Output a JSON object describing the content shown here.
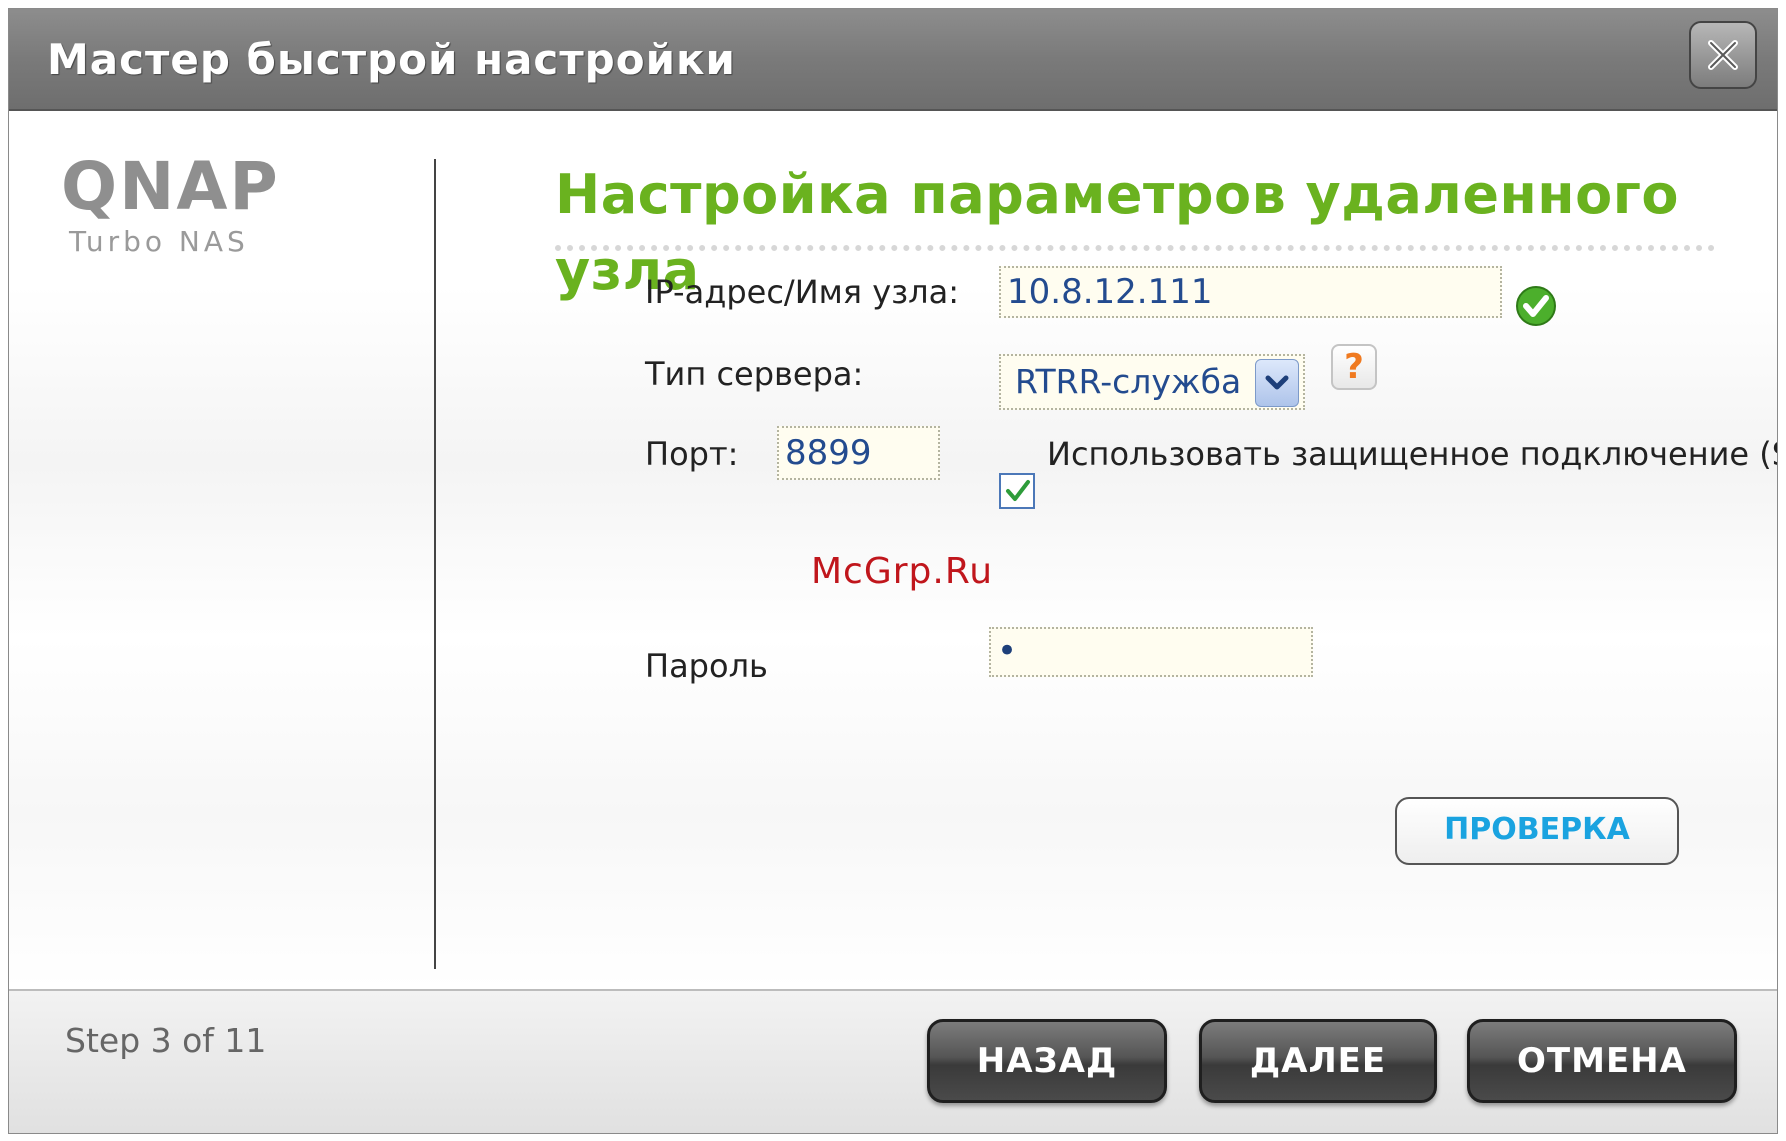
{
  "window": {
    "title": "Мастер быстрой настройки"
  },
  "logo": {
    "brand": "QNAP",
    "subtitle": "Turbo NAS"
  },
  "main": {
    "heading": "Настройка параметров удаленного узла",
    "host": {
      "label": "IP-адрес/Имя узла:",
      "value": "10.8.12.111",
      "status_icon": "check-circle-icon"
    },
    "server_type": {
      "label": "Тип сервера:",
      "value": "RTRR-служба",
      "help_label": "?"
    },
    "port": {
      "label": "Порт:",
      "value": "8899"
    },
    "secure": {
      "checked": true,
      "label": "Использовать защищенное подключение (S"
    },
    "watermark": "McGrp.Ru",
    "password": {
      "label": "Пароль",
      "value": "•"
    },
    "check_button": "ПРОВЕРКА"
  },
  "footer": {
    "step": "Step 3 of 11",
    "back_label": "НАЗАД",
    "next_label": "ДАЛЕЕ",
    "cancel_label": "ОТМЕНА"
  },
  "colors": {
    "heading": "#6ab21f",
    "value_text": "#234b8f",
    "check_button_text": "#1aa3e0",
    "help_mark": "#f07a20",
    "watermark": "#c0161c"
  }
}
